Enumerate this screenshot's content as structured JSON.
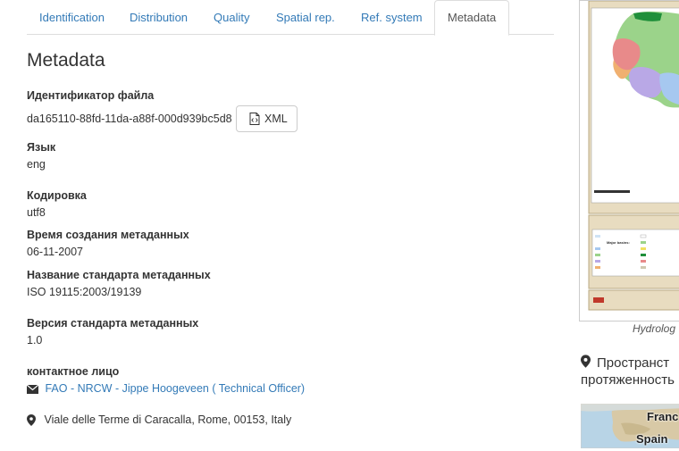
{
  "tabs": [
    {
      "label": "Identification"
    },
    {
      "label": "Distribution"
    },
    {
      "label": "Quality"
    },
    {
      "label": "Spatial rep."
    },
    {
      "label": "Ref. system"
    },
    {
      "label": "Metadata",
      "active": true
    }
  ],
  "section_title": "Metadata",
  "file_identifier": {
    "label": "Идентификатор файла",
    "value": "da165110-88fd-11da-a88f-000d939bc5d8",
    "xml_button": "XML"
  },
  "language": {
    "label": "Язык",
    "value": "eng"
  },
  "encoding": {
    "label": "Кодировка",
    "value": "utf8"
  },
  "date_stamp": {
    "label": "Время создания метаданных",
    "value": "06-11-2007"
  },
  "standard_name": {
    "label": "Название стандарта метаданных",
    "value": "ISO 19115:2003/19139"
  },
  "standard_version": {
    "label": "Версия стандарта метаданных",
    "value": "1.0"
  },
  "contact": {
    "label": "контактное лицо",
    "email_link": "FAO - NRCW - Jippe Hoogeveen ( Technical Officer)",
    "address": "Viale delle Terme di Caracalla, Rome, 00153, Italy"
  },
  "sidebar": {
    "thumbnail_caption": "Hydrolog",
    "extent_title_line1": "Пространст",
    "extent_title_line2": "протяженность",
    "mini_map_labels": [
      "Franc",
      "Spain"
    ],
    "map_legend_heading": "Major basins:",
    "map_legend_items": [
      "Central West Coast",
      "Congo River Basin",
      "East Central Coast",
      "Inland Ocean Coast",
      "Lake Chad",
      "Limpopo Basin",
      "Madagascar",
      "Mediterranean",
      "Niger River",
      "Nile Basin"
    ]
  },
  "colors": {
    "link": "#337ab7",
    "text": "#333333",
    "border": "#dddddd"
  }
}
